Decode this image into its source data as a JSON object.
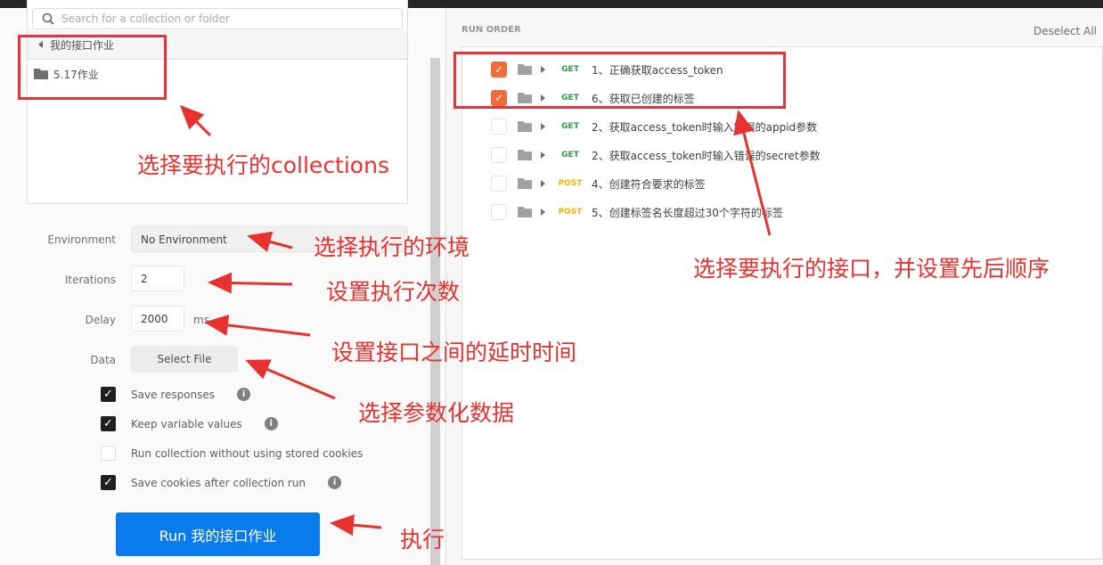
{
  "search": {
    "placeholder": "Search for a collection or folder",
    "icon": "search-icon"
  },
  "collections": {
    "breadcrumb": "我的接口作业",
    "folder": "5.17作业"
  },
  "form": {
    "environment_label": "Environment",
    "environment_value": "No Environment",
    "iterations_label": "Iterations",
    "iterations_value": "2",
    "delay_label": "Delay",
    "delay_value": "2000",
    "delay_unit": "ms",
    "data_label": "Data",
    "select_file": "Select File"
  },
  "options": [
    {
      "label": "Save responses",
      "checked": true,
      "info": true
    },
    {
      "label": "Keep variable values",
      "checked": true,
      "info": true
    },
    {
      "label": "Run collection without using stored cookies",
      "checked": false,
      "info": false
    },
    {
      "label": "Save cookies after collection run",
      "checked": true,
      "info": true
    }
  ],
  "run_button": "Run 我的接口作业",
  "run_order": {
    "title": "RUN ORDER",
    "deselect_all": "Deselect All",
    "items": [
      {
        "method": "GET",
        "name": "1、正确获取access_token",
        "checked": true
      },
      {
        "method": "GET",
        "name": "6、获取已创建的标签",
        "checked": true
      },
      {
        "method": "GET",
        "name": "2、获取access_token时输入错误的appid参数",
        "checked": false
      },
      {
        "method": "GET",
        "name": "2、获取access_token时输入错误的secret参数",
        "checked": false
      },
      {
        "method": "POST",
        "name": "4、创建符合要求的标签",
        "checked": false
      },
      {
        "method": "POST",
        "name": "5、创建标签名长度超过30个字符的标签",
        "checked": false
      }
    ]
  },
  "annotations": {
    "collections": "选择要执行的collections",
    "environment": "选择执行的环境",
    "iterations": "设置执行次数",
    "delay": "设置接口之间的延时时间",
    "data": "选择参数化数据",
    "run": "执行",
    "order": "选择要执行的接口，并设置先后顺序"
  },
  "colors": {
    "accent": "#097bed",
    "checkbox": "#f26b3a",
    "get": "#2b9a4a",
    "post": "#f0b400",
    "annotation": "#e8322f"
  }
}
